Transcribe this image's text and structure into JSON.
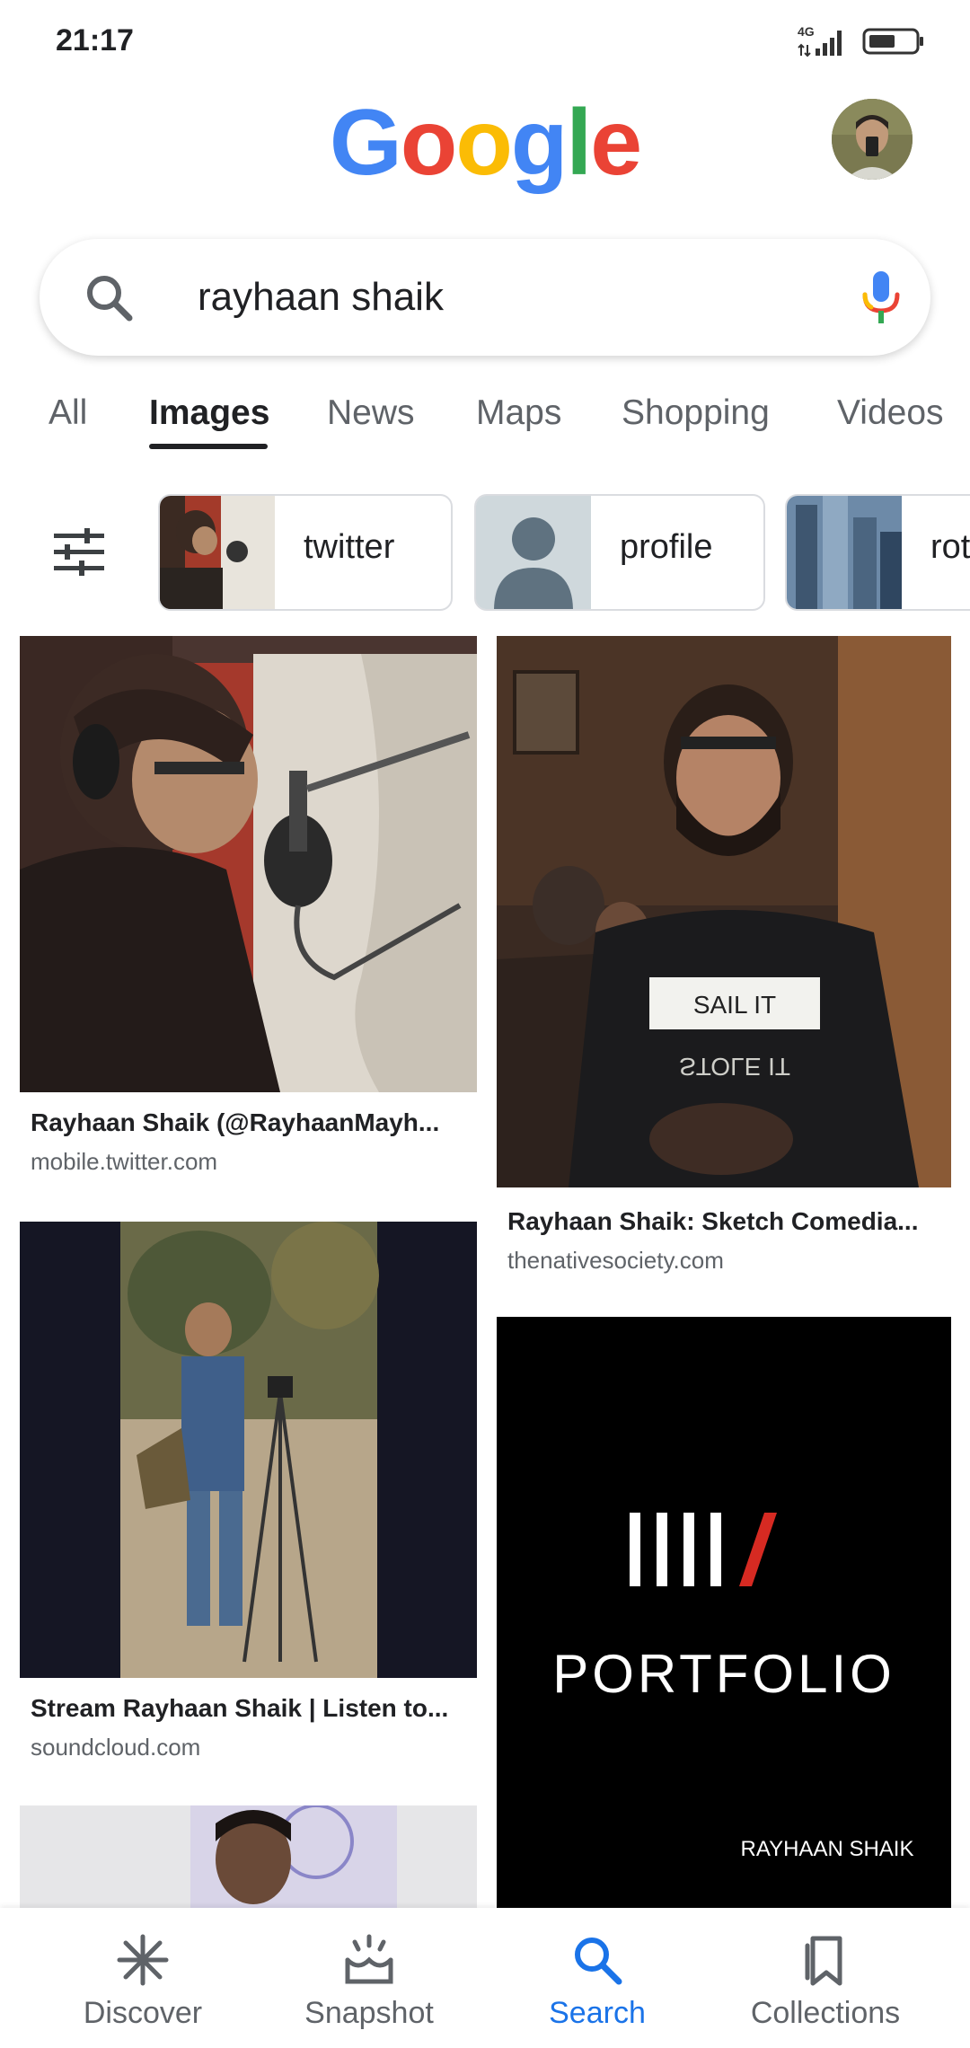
{
  "status_bar": {
    "time": "21:17",
    "network": "4G"
  },
  "header": {
    "logo_letters": [
      "G",
      "o",
      "o",
      "g",
      "l",
      "e"
    ]
  },
  "search": {
    "query": "rayhaan shaik"
  },
  "tabs": [
    {
      "label": "All"
    },
    {
      "label": "Images"
    },
    {
      "label": "News"
    },
    {
      "label": "Maps"
    },
    {
      "label": "Shopping"
    },
    {
      "label": "Videos"
    }
  ],
  "chips": [
    {
      "label": "twitter"
    },
    {
      "label": "profile"
    },
    {
      "label": "rot"
    }
  ],
  "results": [
    {
      "title": "Rayhaan Shaik (@RayhaanMayh...",
      "source": "mobile.twitter.com"
    },
    {
      "title": "Rayhaan Shaik: Sketch Comedia...",
      "source": "thenativesociety.com",
      "shirt_text": [
        "SAIL IT",
        "STOLE IT"
      ]
    },
    {
      "title": "Stream Rayhaan Shaik | Listen to...",
      "source": "soundcloud.com"
    },
    {
      "title": "",
      "source": "",
      "poster_text": [
        "IIII/",
        "PORTFOLIO",
        "RAYHAAN SHAIK"
      ]
    }
  ],
  "bottom_nav": [
    {
      "label": "Discover",
      "icon": "asterisk-icon"
    },
    {
      "label": "Snapshot",
      "icon": "snapshot-icon"
    },
    {
      "label": "Search",
      "icon": "search-icon"
    },
    {
      "label": "Collections",
      "icon": "bookmark-icon"
    }
  ],
  "colors": {
    "google_blue": "#4285F4",
    "google_red": "#EA4335",
    "google_yellow": "#FBBC05",
    "google_green": "#34A853",
    "active_nav": "#1a73e8"
  }
}
